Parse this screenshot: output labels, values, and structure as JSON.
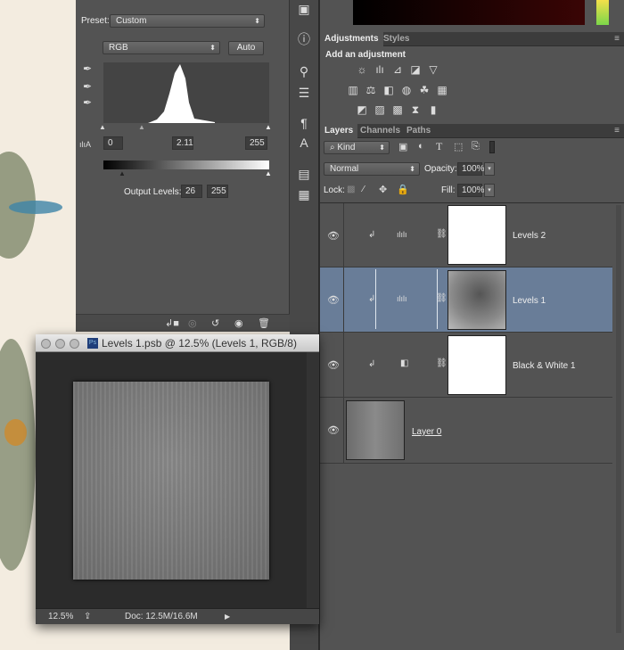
{
  "properties": {
    "preset_label": "Preset:",
    "preset_value": "Custom",
    "channel": "RGB",
    "auto_label": "Auto",
    "input_black": "0",
    "input_gamma": "2.11",
    "input_white": "255",
    "output_label": "Output Levels:",
    "output_black": "26",
    "output_white": "255"
  },
  "adjustments": {
    "tabs": [
      "Adjustments",
      "Styles"
    ],
    "heading": "Add an adjustment",
    "icons": [
      [
        "brightness-contrast",
        "levels",
        "curves",
        "exposure",
        "vibrance"
      ],
      [
        "hue-saturation",
        "color-balance",
        "black-white",
        "photo-filter",
        "channel-mixer",
        "color-lookup"
      ],
      [
        "invert",
        "posterize",
        "threshold",
        "selective-color",
        "gradient-map"
      ]
    ]
  },
  "layers": {
    "tabs": [
      "Layers",
      "Channels",
      "Paths"
    ],
    "filter_kind": "Kind",
    "blend_mode": "Normal",
    "opacity_label": "Opacity:",
    "opacity": "100%",
    "lock_label": "Lock:",
    "fill_label": "Fill:",
    "fill": "100%",
    "items": [
      {
        "name": "Levels 2",
        "type": "levels",
        "selected": false
      },
      {
        "name": "Levels 1",
        "type": "levels",
        "selected": true
      },
      {
        "name": "Black & White 1",
        "type": "black-white",
        "selected": false
      },
      {
        "name": "Layer 0",
        "type": "pixel",
        "selected": false
      }
    ]
  },
  "document": {
    "title": "Levels 1.psb @ 12.5% (Levels 1, RGB/8)",
    "zoom": "12.5%",
    "doc_size": "Doc: 12.5M/16.6M"
  },
  "colors": {
    "selected_layer": "#697d98",
    "panel": "#535353"
  }
}
